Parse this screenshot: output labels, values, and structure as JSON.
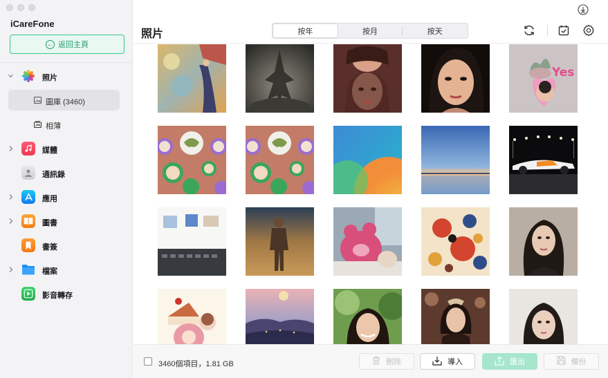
{
  "app": {
    "name": "iCareFone"
  },
  "sidebar": {
    "home_label": "返回主頁",
    "items": [
      {
        "label": "照片",
        "icon": "photos-icon",
        "expandable": true,
        "expanded": true
      },
      {
        "label": "媒體",
        "icon": "music-icon",
        "expandable": true
      },
      {
        "label": "通訊錄",
        "icon": "contacts-icon",
        "expandable": false
      },
      {
        "label": "應用",
        "icon": "app-store-icon",
        "expandable": true
      },
      {
        "label": "圖書",
        "icon": "books-icon",
        "expandable": true
      },
      {
        "label": "書簽",
        "icon": "bookmark-icon",
        "expandable": false
      },
      {
        "label": "檔案",
        "icon": "folder-icon",
        "expandable": true
      },
      {
        "label": "影音轉存",
        "icon": "video-transfer-icon",
        "expandable": false
      }
    ],
    "sub_items": [
      {
        "label": "圖庫 (3460)",
        "icon": "gallery-icon",
        "active": true
      },
      {
        "label": "相薄",
        "icon": "album-icon",
        "active": false
      }
    ]
  },
  "header": {
    "title": "照片",
    "segments": [
      "按年",
      "按月",
      "按天"
    ],
    "selected_segment": "按年"
  },
  "footer": {
    "count": "3460個項目，1.81 GB",
    "buttons": {
      "delete": "刪除",
      "import": "導入",
      "export": "匯出",
      "backup": "備份"
    }
  },
  "colors": {
    "accent": "#37c58d",
    "accent_light": "#a6e6cd",
    "sidebar_bg": "#f3f3f5"
  }
}
